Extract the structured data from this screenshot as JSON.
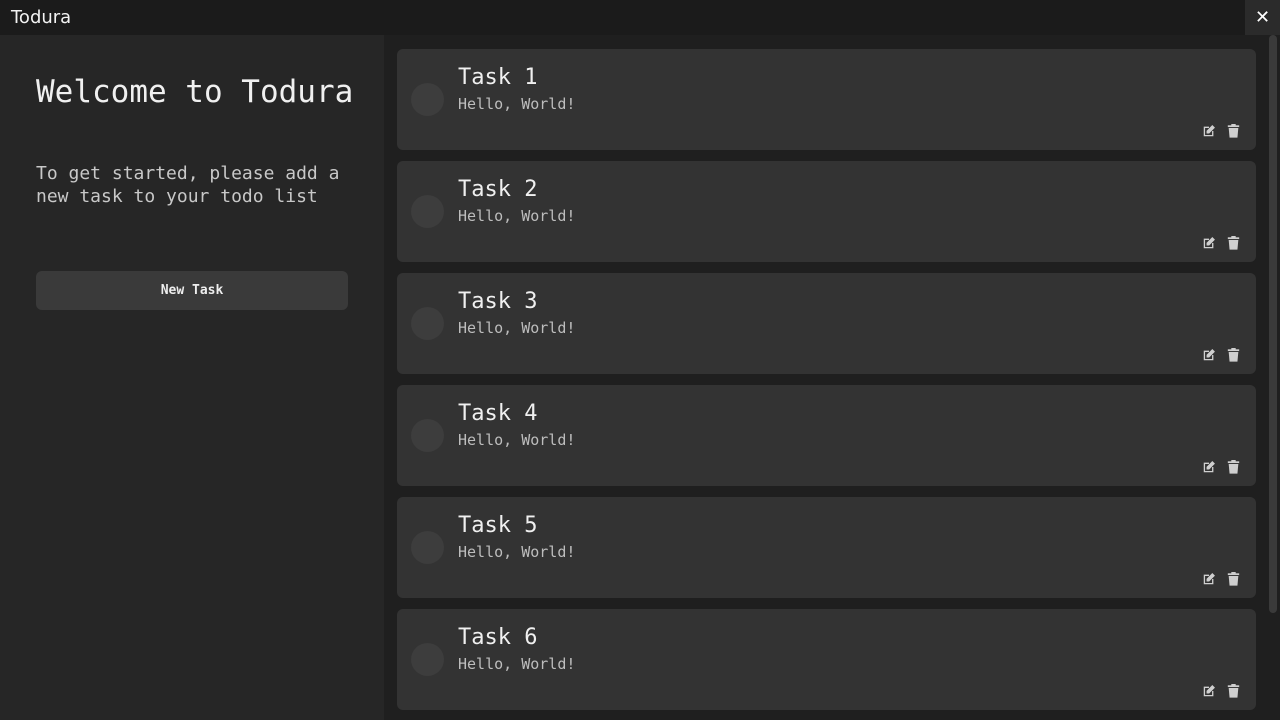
{
  "window": {
    "title": "Todura",
    "close_label": "✕"
  },
  "sidebar": {
    "heading": "Welcome to Todura",
    "subtext": "To get started, please add a new task to your todo list",
    "new_task_label": "New Task"
  },
  "tasks": [
    {
      "title": "Task 1",
      "description": "Hello, World!"
    },
    {
      "title": "Task 2",
      "description": "Hello, World!"
    },
    {
      "title": "Task 3",
      "description": "Hello, World!"
    },
    {
      "title": "Task 4",
      "description": "Hello, World!"
    },
    {
      "title": "Task 5",
      "description": "Hello, World!"
    },
    {
      "title": "Task 6",
      "description": "Hello, World!"
    }
  ],
  "icons": {
    "edit": "edit-icon",
    "delete": "trash-icon",
    "close": "close-icon"
  },
  "colors": {
    "background": "#262626",
    "main_panel": "#1f1f1f",
    "card": "#333333",
    "button": "#3a3a3a",
    "titlebar": "#1b1b1b"
  }
}
